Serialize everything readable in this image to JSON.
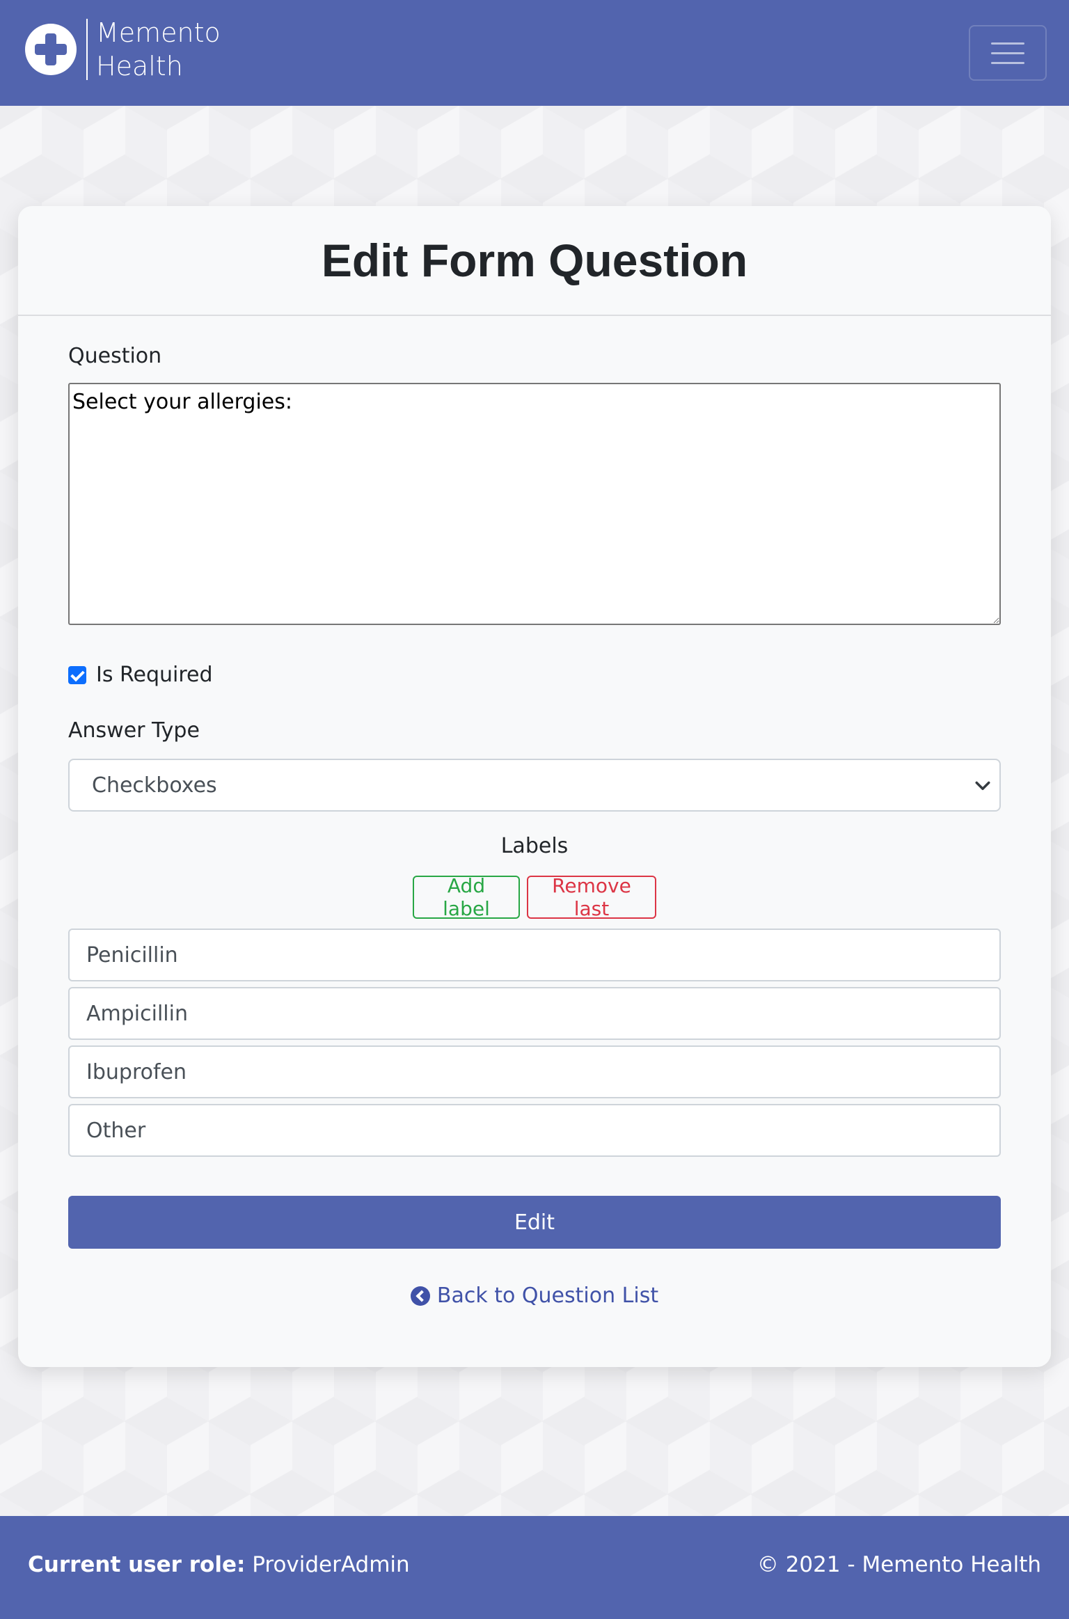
{
  "navbar": {
    "brand_name": "Memento\nHealth",
    "brand_color": "#5264ae"
  },
  "page": {
    "title": "Edit Form Question"
  },
  "form": {
    "question_label": "Question",
    "question_value": "Select your allergies:",
    "is_required_label": "Is Required",
    "is_required_checked": true,
    "answer_type_label": "Answer Type",
    "answer_type_value": "Checkboxes",
    "labels_title": "Labels",
    "add_label_button": "Add label",
    "remove_last_button": "Remove last",
    "labels": [
      "Penicillin",
      "Ampicillin",
      "Ibuprofen",
      "Other"
    ],
    "submit_button": "Edit",
    "back_link": "Back to Question List"
  },
  "footer": {
    "role_label": "Current user role:",
    "role_value": "ProviderAdmin",
    "copyright": "© 2021 - Memento Health"
  },
  "icons": {
    "logo": "medical-cross-icon",
    "menu": "hamburger-menu-icon",
    "select_caret": "chevron-down-icon",
    "back": "chevron-circle-left-icon",
    "required": "checkbox-checked-icon"
  }
}
